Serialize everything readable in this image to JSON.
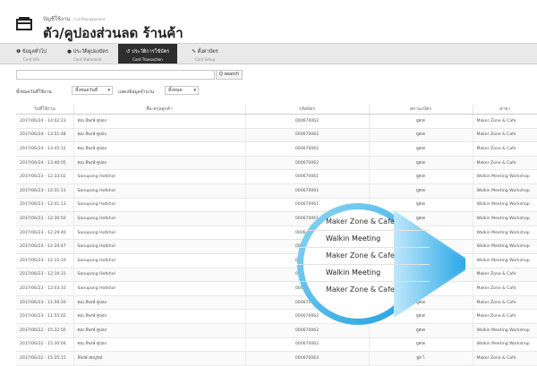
{
  "header": {
    "subtitle": "บัญชีใช้งาน",
    "subtitle_en": "Coll Management",
    "title": "ตัว/คูปองส่วนลด ร้านค้า",
    "icon": "ticket-icon"
  },
  "nav": {
    "tabs": [
      {
        "label": "ข้อมูลทั่วไป",
        "sub": "Card Info",
        "icon": "info-icon",
        "active": false
      },
      {
        "label": "ประวัติคูปองบัตร",
        "sub": "Card Statement",
        "icon": "user-icon",
        "active": false
      },
      {
        "label": "ประวัติการใช้บัตร",
        "sub": "Card Transaction",
        "icon": "history-icon",
        "active": true
      },
      {
        "label": "ตั้งค่าบัตร",
        "sub": "Card Setup",
        "icon": "wrench-icon",
        "active": false
      }
    ]
  },
  "search": {
    "placeholder": "",
    "button": "Q search"
  },
  "filters": {
    "label1": "ทั้งหมดวันที่ใช้งาน",
    "value1": "ทั้งหมดวันที่",
    "label2": "แสดงข้อมูลจำนวน",
    "value2": "ทั้งหมด"
  },
  "table": {
    "headers": [
      "วันที่ใช้งาน",
      "ชื่อ-สกุลลูกค้า",
      "รหัสบัตร",
      "สถานะบัตร",
      "สาขา"
    ],
    "rows": [
      [
        "2017/06/24 - 14:02:23",
        "คุณ ลีพงษ์ คูปอง",
        "000670062",
        "ยูสเด",
        "Maker Zone & Cafe"
      ],
      [
        "2017/06/24 - 13:51:48",
        "คุณ ลีพงษ์ คูปอง",
        "000670062",
        "ยูสเด",
        "Maker Zone & Cafe"
      ],
      [
        "2017/06/24 - 13:45:12",
        "คุณ ลีพงษ์ คูปอง",
        "000670062",
        "ยูสเด",
        "Maker Zone & Cafe"
      ],
      [
        "2017/06/24 - 13:40:05",
        "คุณ ลีพงษ์ คูปอง",
        "000670062",
        "ยูสเด",
        "Maker Zone & Cafe"
      ],
      [
        "2017/06/23 - 12:33:02",
        "Sanupong Hotkhol",
        "000670061",
        "ยูสเด",
        "Walkin Meeting Workshop"
      ],
      [
        "2017/06/23 - 12:31:11",
        "Sanupong Hotkhol",
        "000670061",
        "ยูสเด",
        "Walkin Meeting Workshop"
      ],
      [
        "2017/06/23 - 12:41:13",
        "Sanupong Hotkhol",
        "000670061",
        "ยูสเด",
        "Walkin Meeting Workshop"
      ],
      [
        "2017/06/23 - 12:30:50",
        "Sanupong Hotkhol",
        "000670061",
        "ยูสเด",
        "Walkin Meeting Workshop"
      ],
      [
        "2017/06/23 - 12:29:40",
        "Sanupong Hotkhol",
        "000670061",
        "ยูสเด",
        "Walkin Meeting Workshop"
      ],
      [
        "2017/06/23 - 12:20:47",
        "Sanupong Hotkhol",
        "000670061",
        "ยูสเด",
        "Walkin Meeting Workshop"
      ],
      [
        "2017/06/23 - 12:15:10",
        "Sanupong Hotkhol",
        "000670061",
        "ยูสเด",
        "Walkin Meeting Workshop"
      ],
      [
        "2017/06/23 - 12:10:31",
        "Sanupong Hotkhol",
        "000670061",
        "ยูสเด",
        "Maker Zone & Cafe"
      ],
      [
        "2017/06/23 - 12:03:10",
        "Sanupong Hotkhol",
        "000670061",
        "ยูสเด",
        "Maker Zone & Cafe"
      ],
      [
        "2017/06/23 - 11:59:20",
        "คุณ ลีพงษ์ คูปอง",
        "000670062",
        "ยูสเด",
        "Maker Zone & Cafe"
      ],
      [
        "2017/06/23 - 11:55:02",
        "คุณ ลีพงษ์ คูปอง",
        "000670062",
        "ยูสเด",
        "Maker Zone & Cafe"
      ],
      [
        "2017/06/22 - 15:32:50",
        "คุณ ลีพงษ์ คูปอง",
        "000670062",
        "ยูสเด",
        "Walkin Meeting Workshop"
      ],
      [
        "2017/06/22 - 15:30:04",
        "คุณ ลีพงษ์ คูปอง",
        "000670062",
        "ยูสเด",
        "Walkin Meeting Workshop"
      ],
      [
        "2017/06/22 - 15:25:15",
        "ลีพงษ์ สมบูรณ์",
        "000670063",
        "ยูส ไ",
        "Maker Zone & Cafe"
      ]
    ]
  },
  "magnifier": {
    "lines": [
      "Maker Zone & Cafe",
      "Walkin Meeting",
      "Maker Zone & Cafe",
      "Walkin Meeting",
      "Maker Zone & Cafe"
    ],
    "color": "#3fb4e8"
  }
}
